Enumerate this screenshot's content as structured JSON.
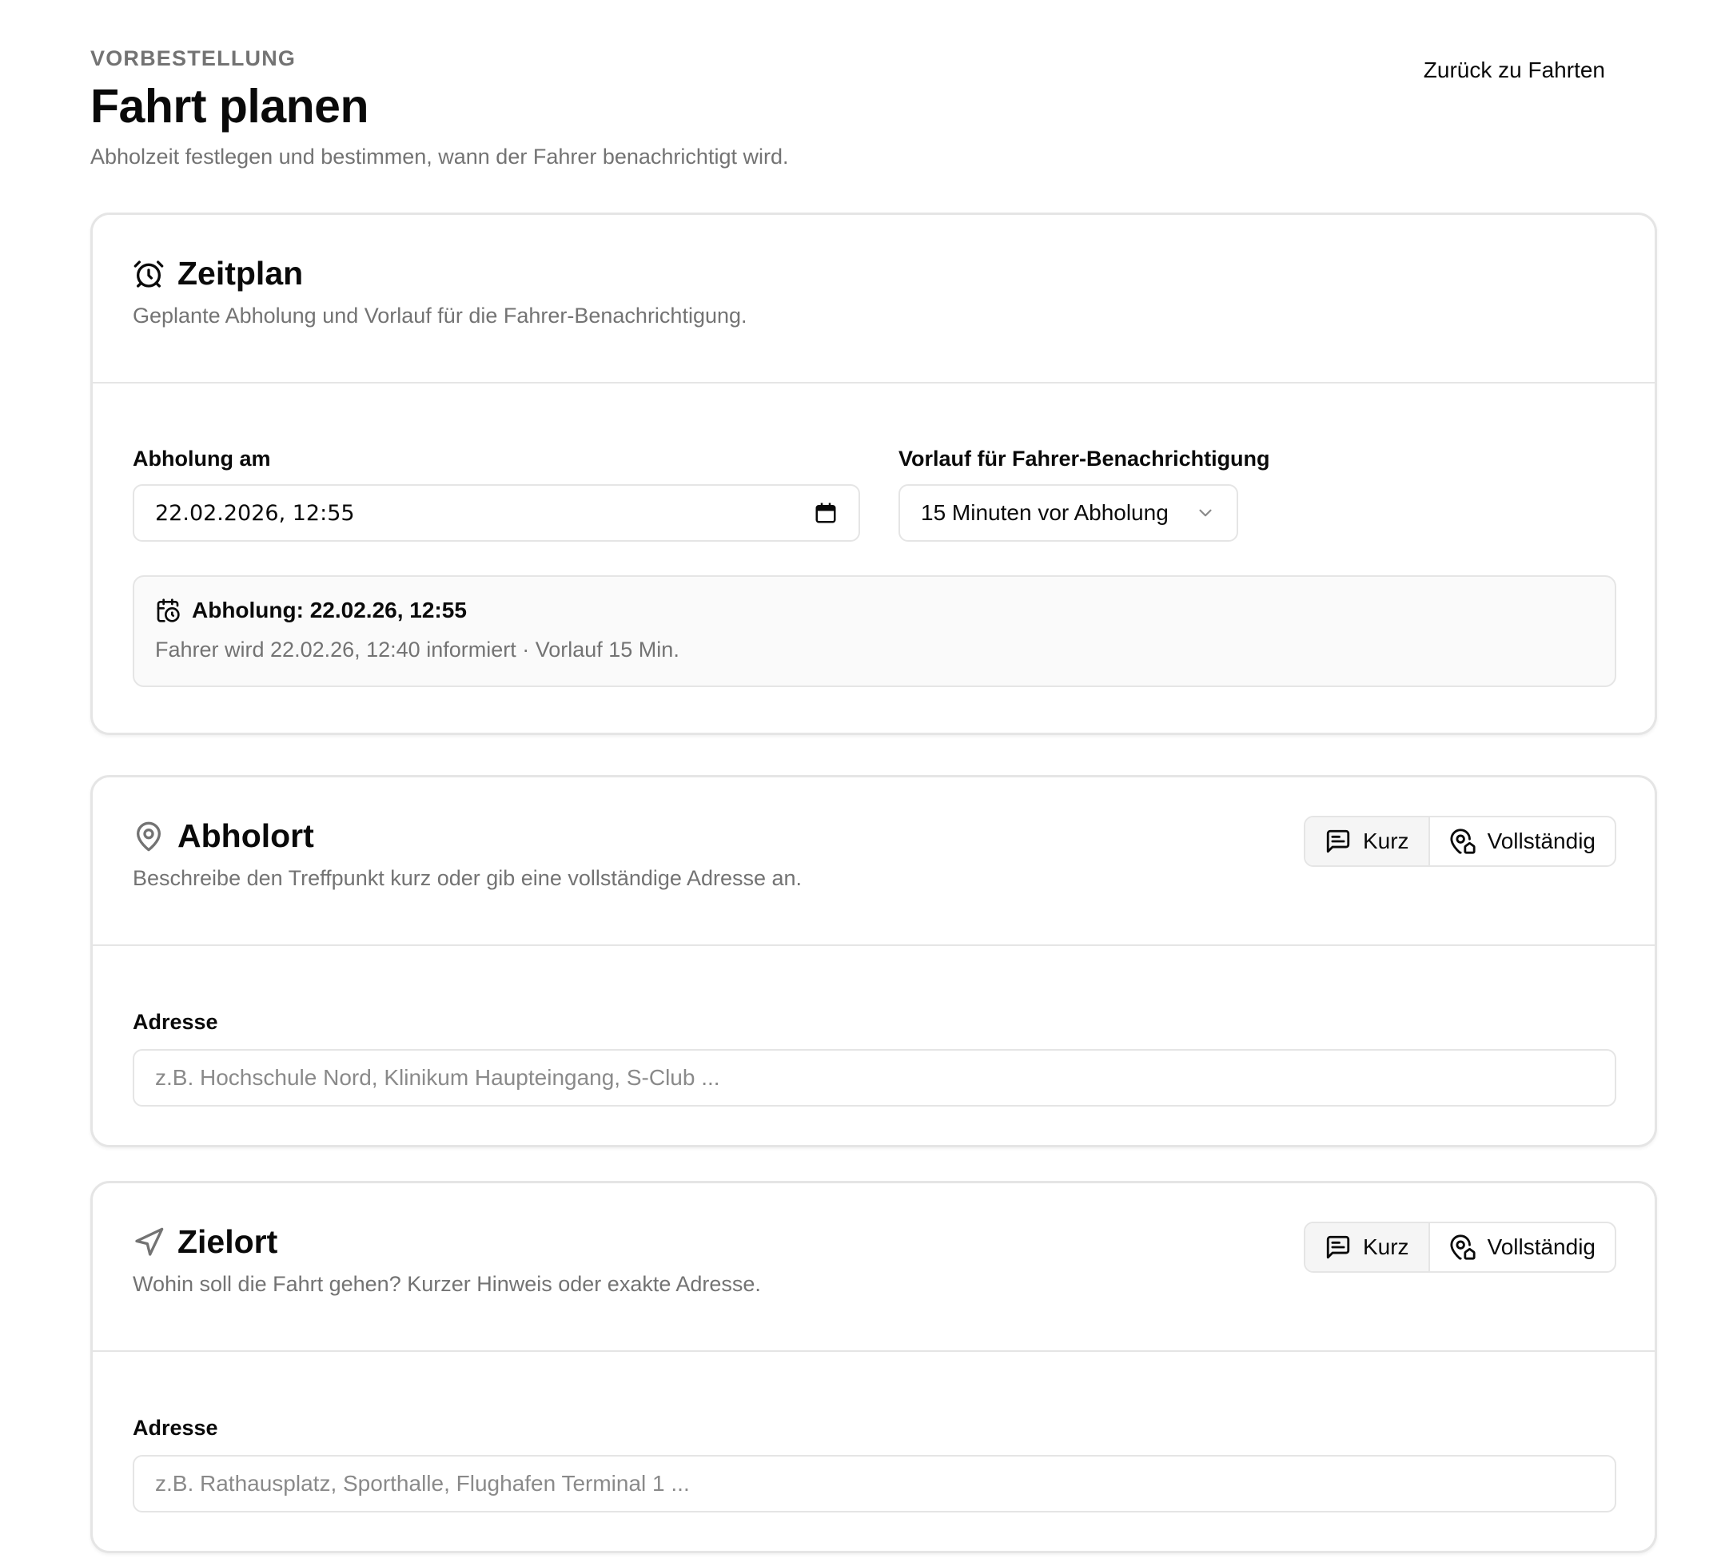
{
  "header": {
    "eyebrow": "VORBESTELLUNG",
    "title": "Fahrt planen",
    "subtitle": "Abholzeit festlegen und bestimmen, wann der Fahrer benachrichtigt wird.",
    "back_link": "Zurück zu Fahrten"
  },
  "schedule": {
    "icon": "alarm-clock-icon",
    "title": "Zeitplan",
    "description": "Geplante Abholung und Vorlauf für die Fahrer-Benachrichtigung.",
    "pickup_label": "Abholung am",
    "pickup_value": "22.02.2026, 12:55",
    "lead_label": "Vorlauf für Fahrer-Benachrichtigung",
    "lead_value": "15 Minuten vor Abholung",
    "summary_title": "Abholung: 22.02.26, 12:55",
    "summary_sub": "Fahrer wird 22.02.26, 12:40 informiert · Vorlauf 15 Min."
  },
  "pickup_location": {
    "icon": "map-pin-icon",
    "title": "Abholort",
    "description": "Beschreibe den Treffpunkt kurz oder gib eine vollständige Adresse an.",
    "toggle_short": "Kurz",
    "toggle_full": "Vollständig",
    "address_label": "Adresse",
    "address_placeholder": "z.B. Hochschule Nord, Klinikum Haupteingang, S-Club ..."
  },
  "destination": {
    "icon": "navigation-icon",
    "title": "Zielort",
    "description": "Wohin soll die Fahrt gehen? Kurzer Hinweis oder exakte Adresse.",
    "toggle_short": "Kurz",
    "toggle_full": "Vollständig",
    "address_label": "Adresse",
    "address_placeholder": "z.B. Rathausplatz, Sporthalle, Flughafen Terminal 1 ..."
  },
  "colors": {
    "text": "#0a0a0a",
    "muted": "#737373",
    "border": "#e5e5e5",
    "surface": "#fafafa"
  }
}
